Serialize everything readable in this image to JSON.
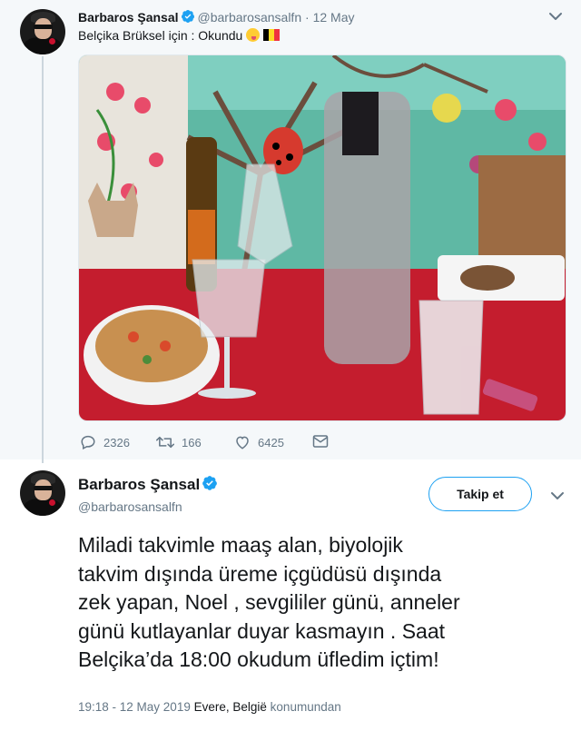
{
  "parent_tweet": {
    "name": "Barbaros Şansal",
    "handle": "@barbarosansalfn",
    "dot": "·",
    "date": "12 May",
    "text": "Belçika Brüksel için : Okundu",
    "emoji_icons": [
      "winking-tongue-face-icon",
      "belgium-flag-icon"
    ],
    "actions": {
      "replies": "2326",
      "retweets": "166",
      "likes": "6425"
    }
  },
  "main_tweet": {
    "name": "Barbaros Şansal",
    "handle": "@barbarosansalfn",
    "follow_label": "Takip et",
    "text_lines": [
      "Miladi takvimle maaş alan, biyolojik",
      "takvim dışında üreme içgüdüsü dışında",
      "zek yapan, Noel , sevgililer günü, anneler",
      "günü kutlayanlar duyar kasmayın . Saat",
      "Belçika’da 18:00 okudum üfledim içtim!"
    ],
    "timestamp": "19:18 - 12 May 2019",
    "location": "Evere, België",
    "location_suffix": "konumundan"
  },
  "colors": {
    "accent": "#1da1f2",
    "muted": "#657786",
    "text": "#14171a",
    "parent_bg": "#f5f8fa"
  }
}
